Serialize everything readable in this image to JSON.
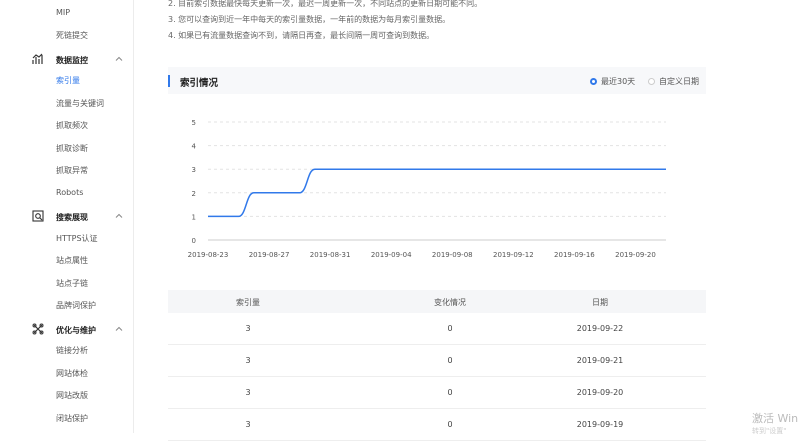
{
  "sidebar": {
    "items_top": [
      {
        "label": "MIP"
      },
      {
        "label": "死链提交"
      }
    ],
    "groups": [
      {
        "label": "数据监控",
        "icon": "chart-bars-icon",
        "items": [
          {
            "label": "索引量",
            "active": true
          },
          {
            "label": "流量与关键词"
          },
          {
            "label": "抓取频次"
          },
          {
            "label": "抓取诊断"
          },
          {
            "label": "抓取异常"
          },
          {
            "label": "Robots"
          }
        ]
      },
      {
        "label": "搜索展现",
        "icon": "search-square-icon",
        "items": [
          {
            "label": "HTTPS认证"
          },
          {
            "label": "站点属性"
          },
          {
            "label": "站点子链"
          },
          {
            "label": "品牌词保护"
          }
        ]
      },
      {
        "label": "优化与维护",
        "icon": "tools-icon",
        "items": [
          {
            "label": "链接分析"
          },
          {
            "label": "网站体检"
          },
          {
            "label": "网站改版"
          },
          {
            "label": "闭站保护"
          }
        ]
      }
    ]
  },
  "notes": [
    "2. 目前索引数据最快每天更新一次，最迟一周更新一次，不同站点的更新日期可能不同。",
    "3. 您可以查询到近一年中每天的索引量数据，一年前的数据为每月索引量数据。",
    "4. 如果已有流量数据查询不到，请隔日再查，最长间隔一周可查询到数据。"
  ],
  "panel": {
    "title": "索引情况",
    "radio_recent": "最近30天",
    "radio_custom": "自定义日期"
  },
  "chart_data": {
    "type": "line",
    "x_ticks": [
      "2019-08-23",
      "2019-08-27",
      "2019-08-31",
      "2019-09-04",
      "2019-09-08",
      "2019-09-12",
      "2019-09-16",
      "2019-09-20"
    ],
    "y_ticks": [
      "0",
      "1",
      "2",
      "3",
      "4",
      "5"
    ],
    "ylim": [
      0,
      5
    ],
    "x": [
      "2019-08-23",
      "2019-08-24",
      "2019-08-25",
      "2019-08-26",
      "2019-08-27",
      "2019-08-28",
      "2019-08-29",
      "2019-08-30",
      "2019-08-31",
      "2019-09-01",
      "2019-09-02",
      "2019-09-03",
      "2019-09-04",
      "2019-09-05",
      "2019-09-06",
      "2019-09-07",
      "2019-09-08",
      "2019-09-09",
      "2019-09-10",
      "2019-09-11",
      "2019-09-12",
      "2019-09-13",
      "2019-09-14",
      "2019-09-15",
      "2019-09-16",
      "2019-09-17",
      "2019-09-18",
      "2019-09-19",
      "2019-09-20",
      "2019-09-21",
      "2019-09-22"
    ],
    "values": [
      1,
      1,
      1,
      2,
      2,
      2,
      2,
      3,
      3,
      3,
      3,
      3,
      3,
      3,
      3,
      3,
      3,
      3,
      3,
      3,
      3,
      3,
      3,
      3,
      3,
      3,
      3,
      3,
      3,
      3,
      3
    ],
    "color": "#3179ea"
  },
  "table": {
    "headers": [
      "索引量",
      "变化情况",
      "日期"
    ],
    "rows": [
      [
        "3",
        "0",
        "2019-09-22"
      ],
      [
        "3",
        "0",
        "2019-09-21"
      ],
      [
        "3",
        "0",
        "2019-09-20"
      ],
      [
        "3",
        "0",
        "2019-09-19"
      ]
    ]
  },
  "watermark": {
    "line1": "激活 Win",
    "line2": "转到\"设置\""
  }
}
